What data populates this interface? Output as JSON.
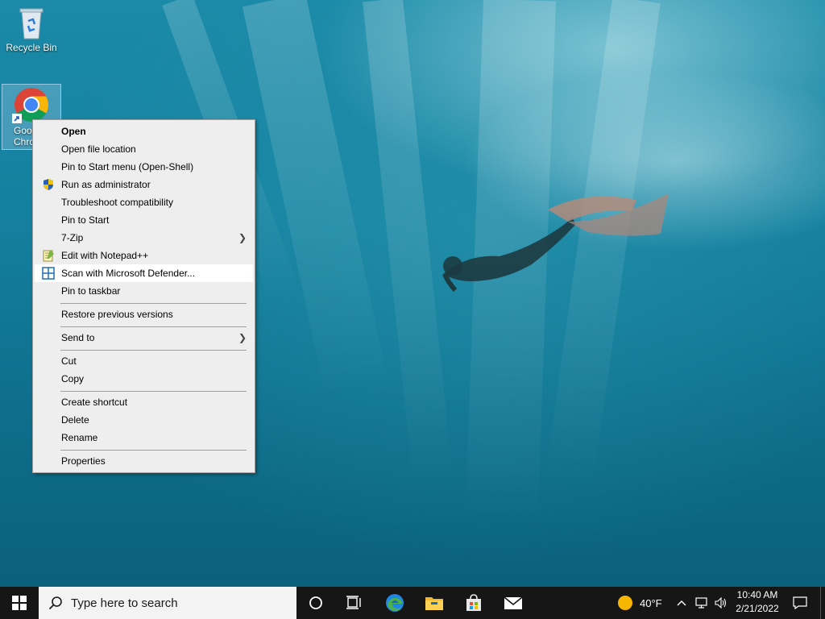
{
  "desktop": {
    "icons": [
      {
        "label": "Recycle Bin",
        "icon": "recycle-bin-icon"
      },
      {
        "label": "Goo\nChro",
        "icon": "chrome-icon"
      }
    ]
  },
  "context_menu": {
    "items": [
      {
        "label": "Open",
        "bold": true
      },
      {
        "label": "Open file location"
      },
      {
        "label": "Pin to Start menu (Open-Shell)"
      },
      {
        "label": "Run as administrator",
        "icon": "uac-shield-icon"
      },
      {
        "label": "Troubleshoot compatibility"
      },
      {
        "label": "Pin to Start"
      },
      {
        "label": "7-Zip",
        "submenu": true
      },
      {
        "label": "Edit with Notepad++",
        "icon": "notepadpp-icon"
      },
      {
        "label": "Scan with Microsoft Defender...",
        "icon": "defender-icon",
        "highlighted": true
      },
      {
        "label": "Pin to taskbar"
      },
      {
        "label": "Restore previous versions"
      },
      {
        "label": "Send to",
        "submenu": true
      },
      {
        "label": "Cut"
      },
      {
        "label": "Copy"
      },
      {
        "label": "Create shortcut"
      },
      {
        "label": "Delete"
      },
      {
        "label": "Rename"
      },
      {
        "label": "Properties"
      }
    ]
  },
  "taskbar": {
    "search_placeholder": "Type here to search",
    "pinned": [
      "cortana-icon",
      "task-view-icon",
      "edge-icon",
      "file-explorer-icon",
      "store-icon",
      "mail-icon"
    ],
    "weather": {
      "temp": "40°F",
      "icon": "sun-icon"
    },
    "tray_icons": [
      "chevron-up-icon",
      "network-icon",
      "volume-icon"
    ],
    "clock": {
      "time": "10:40 AM",
      "date": "2/21/2022"
    },
    "notification_icon": "notification-icon"
  },
  "colors": {
    "water_top": "#1a8aa8",
    "water_bottom": "#0a5e78",
    "menu_bg": "#eeeeee",
    "menu_highlight": "#ffffff",
    "taskbar_bg": "#161616"
  }
}
